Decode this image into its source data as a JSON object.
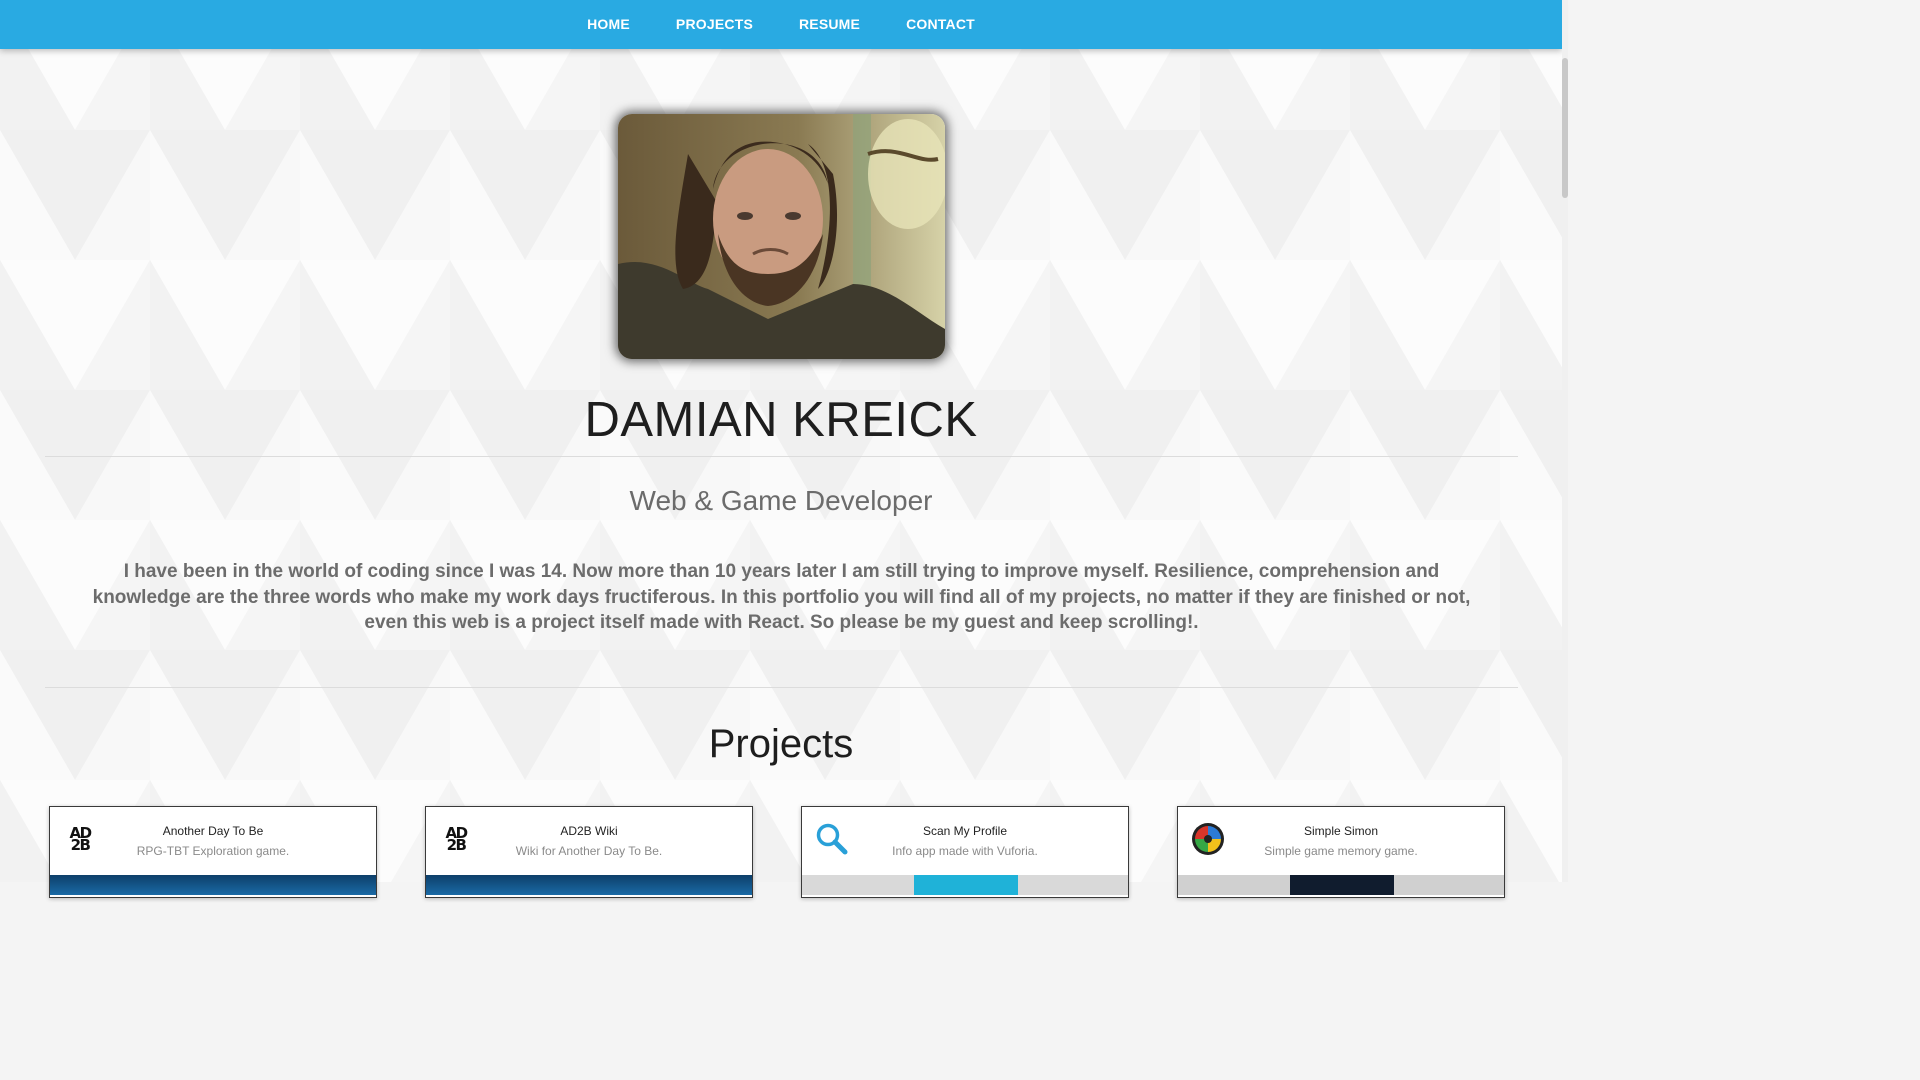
{
  "nav": {
    "items": [
      {
        "label": "HOME"
      },
      {
        "label": "PROJECTS"
      },
      {
        "label": "RESUME"
      },
      {
        "label": "CONTACT"
      }
    ]
  },
  "profile": {
    "name": "DAMIAN KREICK",
    "role": "Web & Game Developer",
    "bio": "I have been in the world of coding since I was 14. Now more than 10 years later I am still trying to improve myself. Resilience, comprehension and knowledge are the three words who make my work days fructiferous. In this portfolio you will find all of my projects, no matter if they are finished or not, even this web is a project itself made with React. So please be my guest and keep scrolling!."
  },
  "projects": {
    "title": "Projects",
    "cards": [
      {
        "title": "Another Day To Be",
        "desc": "RPG-TBT Exploration game.",
        "icon": "ad2b-logo-icon",
        "logo_text": "AD2B"
      },
      {
        "title": "AD2B Wiki",
        "desc": "Wiki for Another Day To Be.",
        "icon": "ad2b-logo-icon",
        "logo_text": "AD2B"
      },
      {
        "title": "Scan My Profile",
        "desc": "Info app made with Vuforia.",
        "icon": "magnifier-icon"
      },
      {
        "title": "Simple Simon",
        "desc": "Simple game memory game.",
        "icon": "simon-icon"
      }
    ]
  },
  "colors": {
    "navbar": "#29aae2",
    "accent_blue": "#29aae2",
    "text_dark": "#1e1e1e",
    "text_muted": "#6c6c6c"
  }
}
